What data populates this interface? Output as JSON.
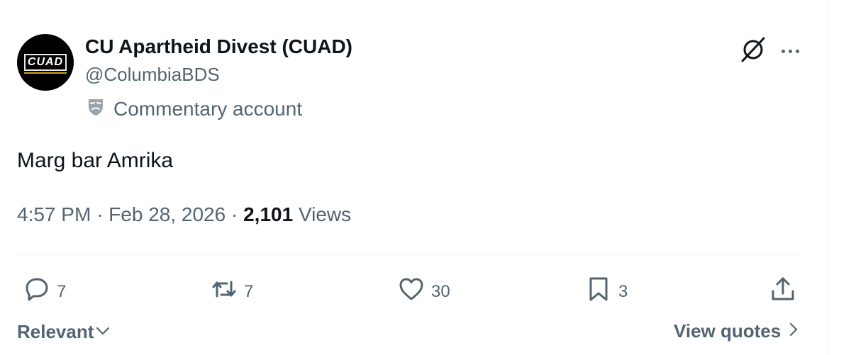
{
  "author": {
    "display_name": "CU Apartheid Divest (CUAD)",
    "handle": "@ColumbiaBDS",
    "avatar_text": "CUAD",
    "label_icon": "theater-masks-icon",
    "label_text": "Commentary account"
  },
  "header_icons": [
    "grok-icon",
    "more-icon"
  ],
  "tweet": {
    "text": "Marg bar Amrika"
  },
  "meta": {
    "time": "4:57 PM",
    "separator": "·",
    "date": "Feb 28, 2026",
    "views_count": "2,101",
    "views_label": "Views"
  },
  "actions": {
    "replies": "7",
    "reposts": "7",
    "likes": "30",
    "bookmarks": "3"
  },
  "footer": {
    "sort_label": "Relevant",
    "view_quotes_label": "View quotes"
  },
  "colors": {
    "text_primary": "#0f1419",
    "text_secondary": "#536471",
    "divider": "#eff3f4"
  }
}
